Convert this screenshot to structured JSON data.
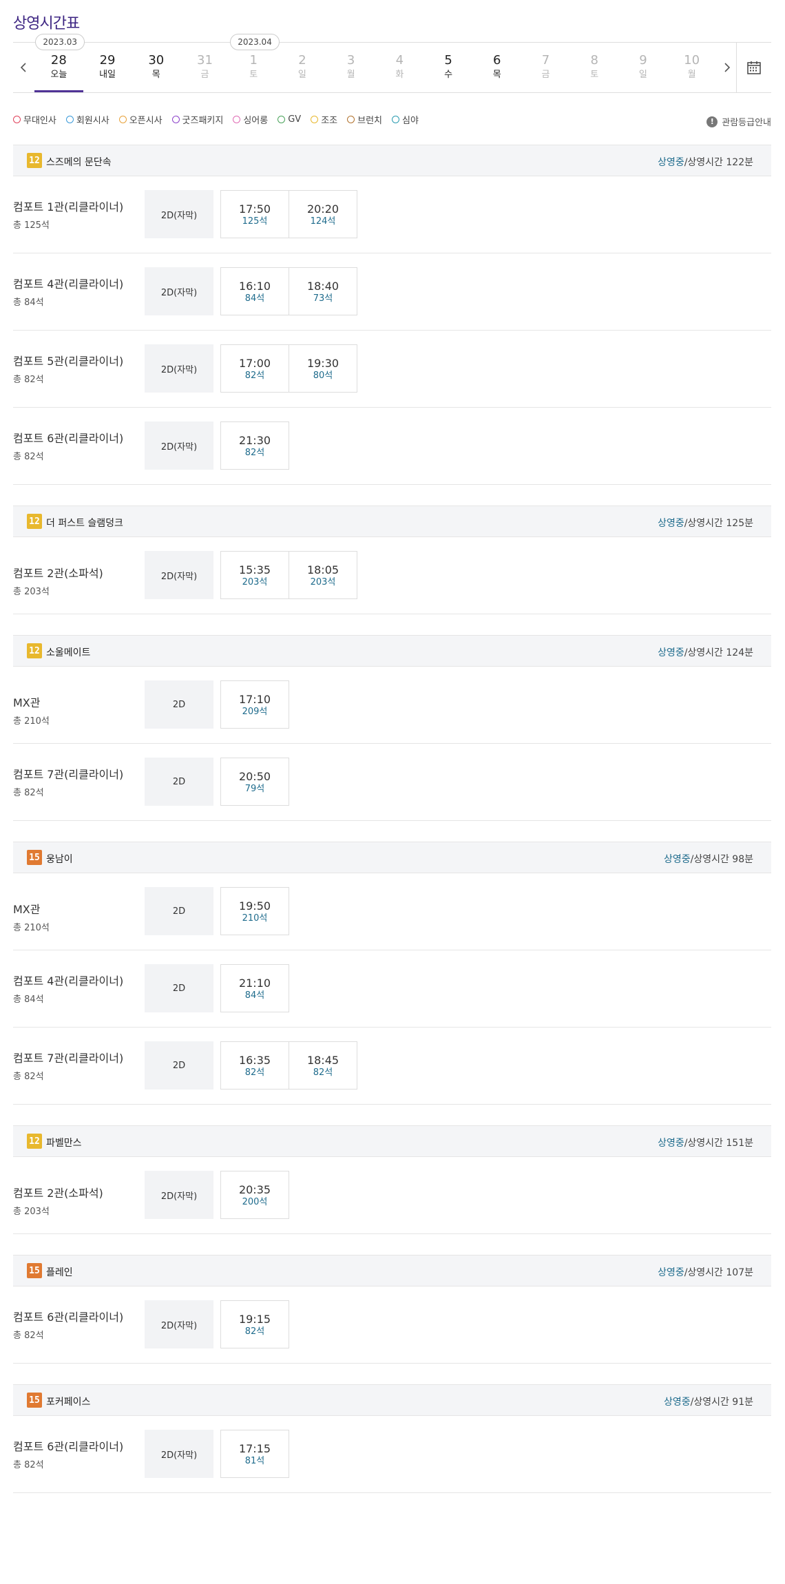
{
  "page_title": "상영시간표",
  "date_nav": {
    "prev_icon": "chevron-left-icon",
    "next_icon": "chevron-right-icon",
    "calendar_icon": "calendar-icon",
    "months": [
      "2023.03",
      "2023.04"
    ],
    "days": [
      {
        "num": "28",
        "name": "오늘",
        "today": true,
        "dim": false
      },
      {
        "num": "29",
        "name": "내일",
        "today": false,
        "dim": false
      },
      {
        "num": "30",
        "name": "목",
        "today": false,
        "dim": false
      },
      {
        "num": "31",
        "name": "금",
        "today": false,
        "dim": true
      },
      {
        "num": "1",
        "name": "토",
        "today": false,
        "dim": true
      },
      {
        "num": "2",
        "name": "일",
        "today": false,
        "dim": true
      },
      {
        "num": "3",
        "name": "월",
        "today": false,
        "dim": true
      },
      {
        "num": "4",
        "name": "화",
        "today": false,
        "dim": true
      },
      {
        "num": "5",
        "name": "수",
        "today": false,
        "dim": false
      },
      {
        "num": "6",
        "name": "목",
        "today": false,
        "dim": false
      },
      {
        "num": "7",
        "name": "금",
        "today": false,
        "dim": true
      },
      {
        "num": "8",
        "name": "토",
        "today": false,
        "dim": true
      },
      {
        "num": "9",
        "name": "일",
        "today": false,
        "dim": true
      },
      {
        "num": "10",
        "name": "월",
        "today": false,
        "dim": true
      }
    ]
  },
  "legend": [
    {
      "label": "무대인사",
      "color": "#e0415a"
    },
    {
      "label": "회원시사",
      "color": "#3a9ad9"
    },
    {
      "label": "오픈시사",
      "color": "#e8a23a"
    },
    {
      "label": "굿즈패키지",
      "color": "#8a3fc9"
    },
    {
      "label": "싱어롱",
      "color": "#e06bb4"
    },
    {
      "label": "GV",
      "color": "#4aa35a"
    },
    {
      "label": "조조",
      "color": "#e8b82e"
    },
    {
      "label": "브런치",
      "color": "#b0702a"
    },
    {
      "label": "심야",
      "color": "#2a9bb0"
    }
  ],
  "rating_guide": {
    "label": "관람등급안내",
    "icon": "exclamation-icon"
  },
  "movies": [
    {
      "title": "스즈메의 문단속",
      "age": "12",
      "status": "상영중",
      "runtime": "/상영시간 122분",
      "halls": [
        {
          "name": "컴포트 1관(리클라이너)",
          "seats": "총 125석",
          "type": "2D(자막)",
          "times": [
            {
              "time": "17:50",
              "seats": "125석"
            },
            {
              "time": "20:20",
              "seats": "124석"
            }
          ]
        },
        {
          "name": "컴포트 4관(리클라이너)",
          "seats": "총 84석",
          "type": "2D(자막)",
          "times": [
            {
              "time": "16:10",
              "seats": "84석"
            },
            {
              "time": "18:40",
              "seats": "73석"
            }
          ]
        },
        {
          "name": "컴포트 5관(리클라이너)",
          "seats": "총 82석",
          "type": "2D(자막)",
          "times": [
            {
              "time": "17:00",
              "seats": "82석"
            },
            {
              "time": "19:30",
              "seats": "80석"
            }
          ]
        },
        {
          "name": "컴포트 6관(리클라이너)",
          "seats": "총 82석",
          "type": "2D(자막)",
          "times": [
            {
              "time": "21:30",
              "seats": "82석"
            }
          ]
        }
      ]
    },
    {
      "title": "더 퍼스트 슬램덩크",
      "age": "12",
      "status": "상영중",
      "runtime": "/상영시간 125분",
      "halls": [
        {
          "name": "컴포트 2관(소파석)",
          "seats": "총 203석",
          "type": "2D(자막)",
          "times": [
            {
              "time": "15:35",
              "seats": "203석"
            },
            {
              "time": "18:05",
              "seats": "203석"
            }
          ]
        }
      ]
    },
    {
      "title": "소울메이트",
      "age": "12",
      "status": "상영중",
      "runtime": "/상영시간 124분",
      "halls": [
        {
          "name": "MX관",
          "seats": "총 210석",
          "type": "2D",
          "times": [
            {
              "time": "17:10",
              "seats": "209석"
            }
          ]
        },
        {
          "name": "컴포트 7관(리클라이너)",
          "seats": "총 82석",
          "type": "2D",
          "times": [
            {
              "time": "20:50",
              "seats": "79석"
            }
          ]
        }
      ]
    },
    {
      "title": "웅남이",
      "age": "15",
      "status": "상영중",
      "runtime": "/상영시간 98분",
      "halls": [
        {
          "name": "MX관",
          "seats": "총 210석",
          "type": "2D",
          "times": [
            {
              "time": "19:50",
              "seats": "210석"
            }
          ]
        },
        {
          "name": "컴포트 4관(리클라이너)",
          "seats": "총 84석",
          "type": "2D",
          "times": [
            {
              "time": "21:10",
              "seats": "84석"
            }
          ]
        },
        {
          "name": "컴포트 7관(리클라이너)",
          "seats": "총 82석",
          "type": "2D",
          "times": [
            {
              "time": "16:35",
              "seats": "82석"
            },
            {
              "time": "18:45",
              "seats": "82석"
            }
          ]
        }
      ]
    },
    {
      "title": "파벨만스",
      "age": "12",
      "status": "상영중",
      "runtime": "/상영시간 151분",
      "halls": [
        {
          "name": "컴포트 2관(소파석)",
          "seats": "총 203석",
          "type": "2D(자막)",
          "times": [
            {
              "time": "20:35",
              "seats": "200석"
            }
          ]
        }
      ]
    },
    {
      "title": "플레인",
      "age": "15",
      "status": "상영중",
      "runtime": "/상영시간 107분",
      "halls": [
        {
          "name": "컴포트 6관(리클라이너)",
          "seats": "총 82석",
          "type": "2D(자막)",
          "times": [
            {
              "time": "19:15",
              "seats": "82석"
            }
          ]
        }
      ]
    },
    {
      "title": "포커페이스",
      "age": "15",
      "status": "상영중",
      "runtime": "/상영시간 91분",
      "halls": [
        {
          "name": "컴포트 6관(리클라이너)",
          "seats": "총 82석",
          "type": "2D(자막)",
          "times": [
            {
              "time": "17:15",
              "seats": "81석"
            }
          ]
        }
      ]
    }
  ]
}
